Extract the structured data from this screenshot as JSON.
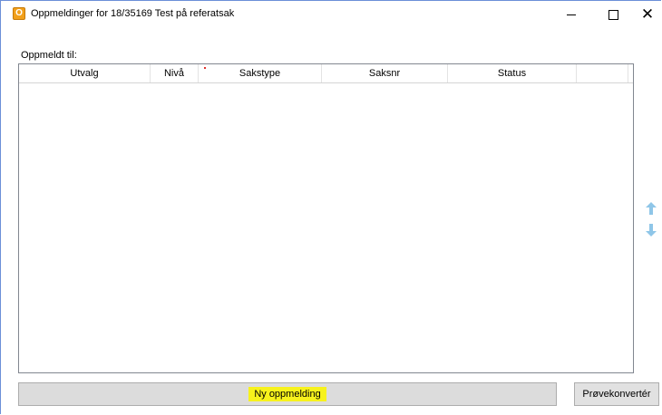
{
  "window": {
    "app_icon_letter": "O",
    "title": "Oppmeldinger for 18/35169 Test på referatsak",
    "minimize_glyph": "—",
    "maximize_glyph": "☐",
    "close_glyph": "✕"
  },
  "form": {
    "oppmeldt_label": "Oppmeldt til:"
  },
  "grid": {
    "columns": [
      "Utvalg",
      "Nivå",
      "Sakstype",
      "Saksnr",
      "Status",
      ""
    ],
    "rows": []
  },
  "side_arrows": {
    "up_icon": "arrow-up-icon",
    "down_icon": "arrow-down-icon",
    "color": "#8fc6e8"
  },
  "buttons": {
    "new_registration": "Ny oppmelding",
    "test_convert": "Prøvekonvertér",
    "highlight_color": "#f7f21c"
  }
}
